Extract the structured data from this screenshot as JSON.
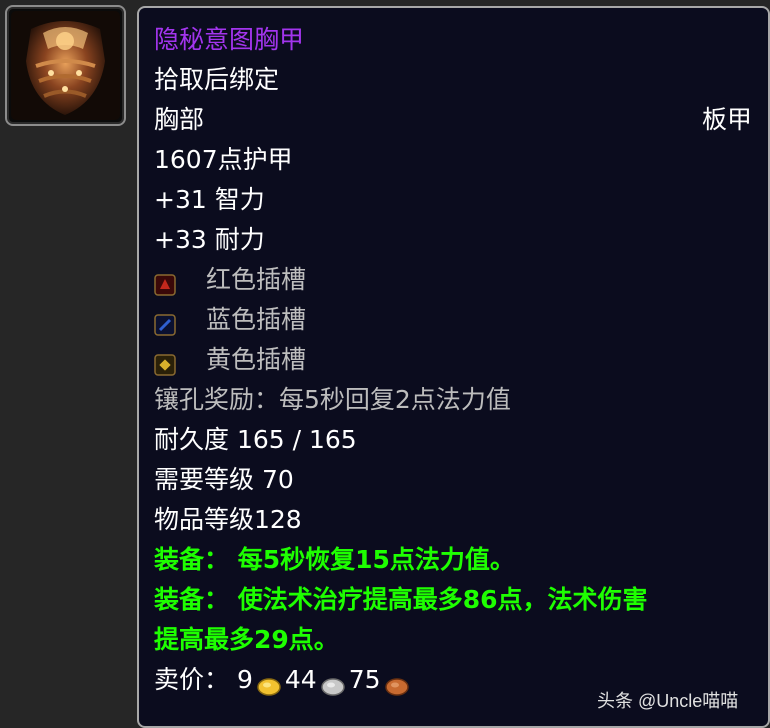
{
  "item": {
    "name": "隐秘意图胸甲",
    "bind": "拾取后绑定",
    "slot": "胸部",
    "armor_type": "板甲",
    "armor": "1607点护甲",
    "stats": [
      "+31 智力",
      "+33 耐力"
    ],
    "sockets": [
      {
        "icon": "red-socket-icon",
        "label": "红色插槽",
        "color": "#c0281c"
      },
      {
        "icon": "blue-socket-icon",
        "label": "蓝色插槽",
        "color": "#2f5fd0"
      },
      {
        "icon": "yellow-socket-icon",
        "label": "黄色插槽",
        "color": "#d8b02c"
      }
    ],
    "socket_bonus": "镶孔奖励：每5秒回复2点法力值",
    "durability": "耐久度 165 / 165",
    "required_level": "需要等级 70",
    "item_level": "物品等级128",
    "equip_1": "装备：   每5秒恢复15点法力值。",
    "equip_2_line1": "装备：   使法术治疗提高最多86点，法术伤害",
    "equip_2_line2": "提高最多29点。",
    "sell_label": "卖价：",
    "sell_gold": "9",
    "sell_silver": "44",
    "sell_copper": "75"
  },
  "colors": {
    "epic_purple": "#a335ee",
    "equip_green": "#1eff00",
    "gray_text": "#bdbdbd",
    "tooltip_bg": "#0b0c1e"
  },
  "watermark": "头条 @Uncle喵喵"
}
